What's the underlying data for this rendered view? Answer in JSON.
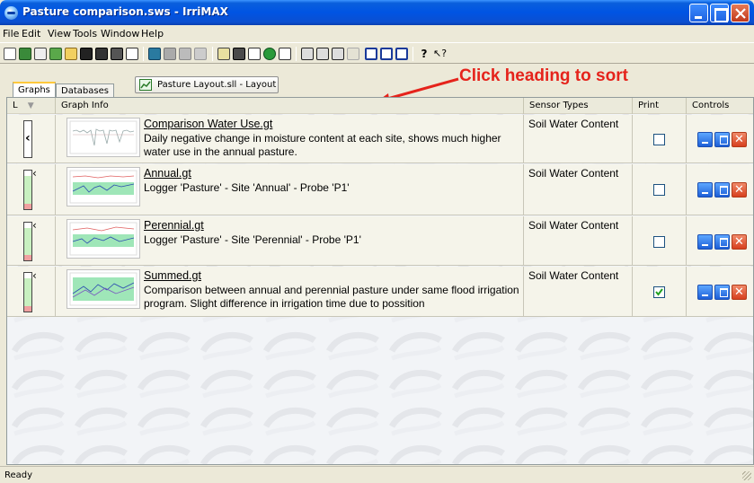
{
  "window": {
    "title": "Pasture comparison.sws - IrriMAX"
  },
  "menu": {
    "items": [
      "File",
      "Edit",
      "View",
      "Tools",
      "Window",
      "Help"
    ]
  },
  "tabs": {
    "graphs": "Graphs",
    "databases": "Databases",
    "layout_button": "Pasture Layout.sll - Layout"
  },
  "annotation": {
    "text": "Click heading to sort",
    "color": "#e5231b"
  },
  "table": {
    "headers": {
      "l": "L",
      "graph_info": "Graph Info",
      "sensor_types": "Sensor Types",
      "print": "Print",
      "controls": "Controls"
    },
    "rows": [
      {
        "title": "Comparison Water Use.gt",
        "description": "Daily negative change in moisture content at each site, shows much higher water use in the annual pasture.",
        "sensor_type": "Soil Water Content",
        "print_checked": false
      },
      {
        "title": "Annual.gt",
        "description": "Logger 'Pasture' - Site 'Annual' - Probe 'P1'",
        "sensor_type": "Soil Water Content",
        "print_checked": false
      },
      {
        "title": "Perennial.gt",
        "description": "Logger 'Pasture' - Site 'Perennial' - Probe 'P1'",
        "sensor_type": "Soil Water Content",
        "print_checked": false
      },
      {
        "title": "Summed.gt",
        "description": "Comparison between annual and perennial pasture under same flood irrigation program. Slight difference in irrigation time due to possition",
        "sensor_type": "Soil Water Content",
        "print_checked": true
      }
    ]
  },
  "status": {
    "text": "Ready"
  },
  "colors": {
    "titlebar": "#0054e3",
    "window_bg": "#ece9d8",
    "row_bg": "#f5f4ea",
    "gauge_green": "#c8f0c0",
    "gauge_red": "#f0a0a0"
  }
}
